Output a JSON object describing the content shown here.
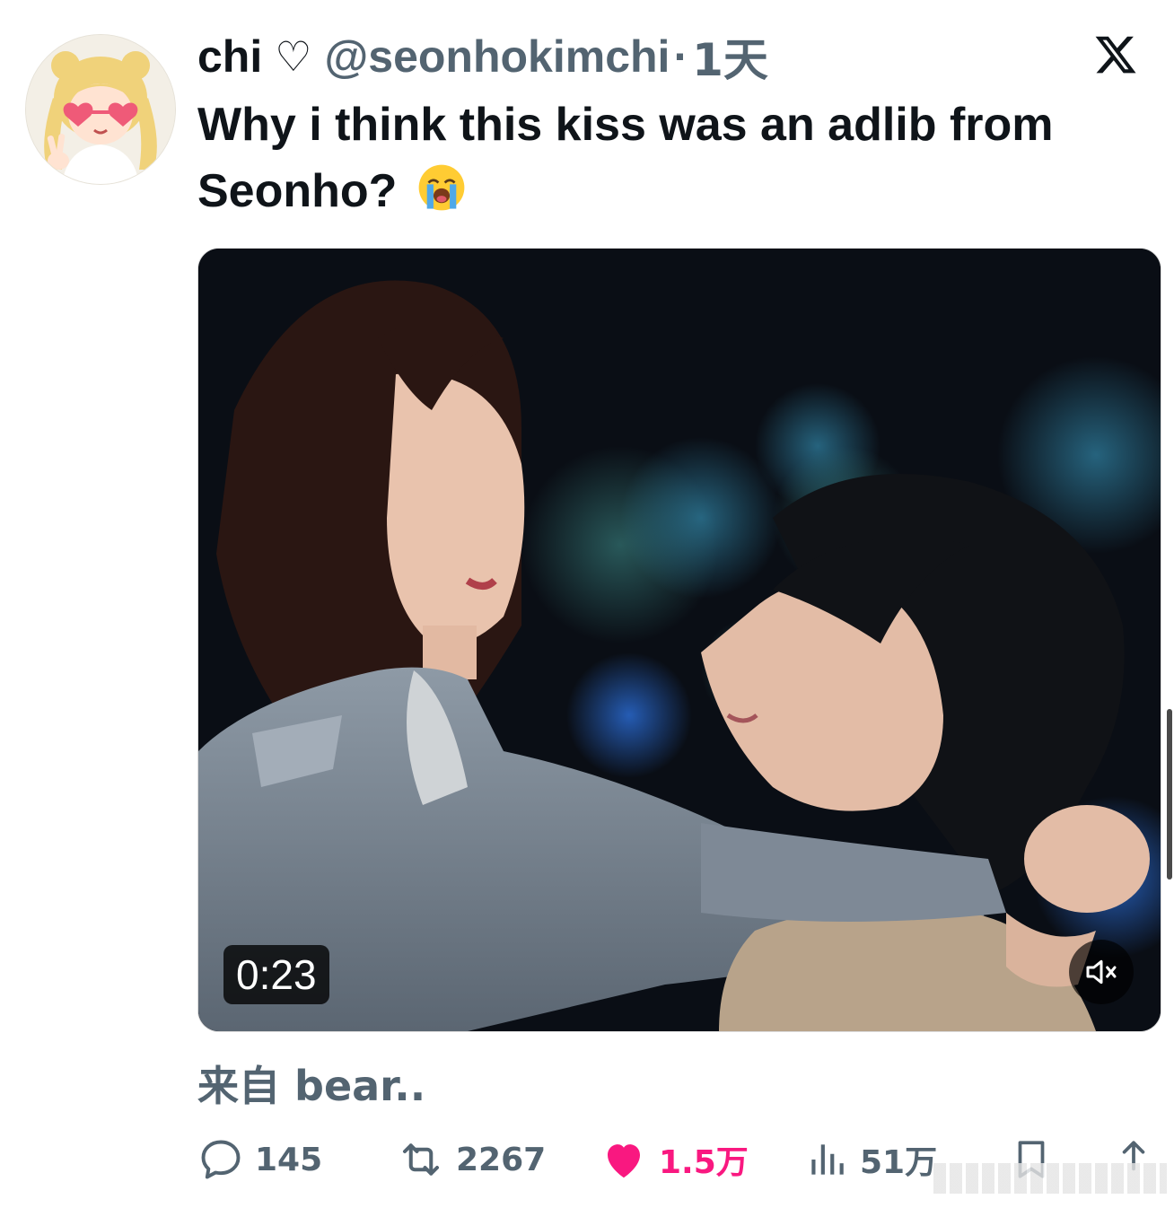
{
  "author": {
    "display_name": "chi",
    "name_symbol": "♡",
    "handle": "@seonhokimchi",
    "separator": "·",
    "time": "1天"
  },
  "tweet": {
    "text": "Why i think this kiss was an adlib from Seonho?",
    "emoji": "loudly-crying-face"
  },
  "media": {
    "duration": "0:23",
    "mute_icon": "speaker-muted-icon"
  },
  "source": {
    "text": "来自 bear.."
  },
  "actions": {
    "replies": "145",
    "retweets": "2267",
    "likes": "1.5万",
    "views": "51万"
  },
  "colors": {
    "like": "#f91880",
    "secondary_text": "#536471",
    "primary_text": "#0f1419"
  }
}
